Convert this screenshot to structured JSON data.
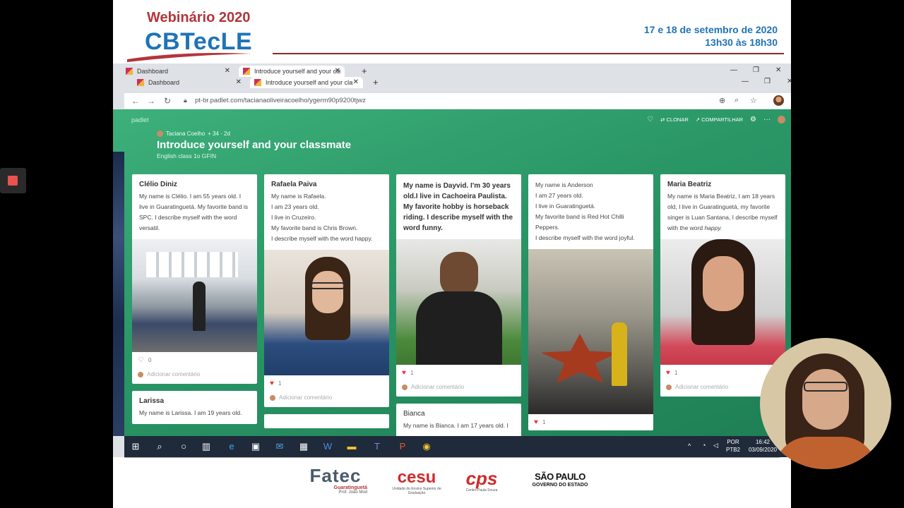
{
  "slide": {
    "webinar": "Webinário 2020",
    "event": "CBTecLE",
    "date": "17 e 18 de setembro de 2020",
    "time": "13h30 às 18h30"
  },
  "browser": {
    "tabs_back": [
      {
        "label": "Dashboard"
      },
      {
        "label": "Introduce yourself and your classm"
      }
    ],
    "tabs_front": [
      {
        "label": "Dashboard"
      },
      {
        "label": "Introduce yourself and your classm"
      }
    ],
    "url": "pt-br.padlet.com/tacianaoliveiracoelho/ygerm90p9200tjwz"
  },
  "padlet": {
    "brand": "padlet",
    "author": "Taciana Coelho",
    "author_stats": "+ 34 · 2d",
    "title": "Introduce yourself and your classmate",
    "subtitle": "English class 1o GFIN",
    "toolbar": {
      "clone": "CLONAR",
      "share": "COMPARTILHAR"
    },
    "add_comment": "Adicionar comentário",
    "cards": [
      {
        "title": "Clélio Diniz",
        "body": "My name is Clélio. I am 55 years old. I live in Guaratinguetá. My favorite band is SPC. I describe myself with the word versatil.",
        "likes": "0"
      },
      {
        "title": "Rafaela Paiva",
        "lines": [
          "My name is Rafaela.",
          "I am 23 years old.",
          "I live in Cruzeiro.",
          "My favorite band is Chris Brown.",
          "I describe myself with the word happy."
        ],
        "likes": "1"
      },
      {
        "title": "",
        "body": "My name is Dayvid. I'm 30 years old.I live in Cachoeira Paulista. My favorite hobby is horseback riding. I describe myself with the word funny.",
        "likes": "1"
      },
      {
        "title": "",
        "lines": [
          "My name is Anderson",
          "I am 27 years old.",
          "I live in Guaratinguetá.",
          "My favorite band is Red Hot Chilli Peppers.",
          "I describe myself with the word joyful."
        ],
        "likes": "1"
      },
      {
        "title": "Maria Beatriz",
        "body_pre": "My name is Maria Beatriz, I am 18 years old, I live in Guaratinguetá, my favorite singer is Luan Santana, I describe myself with the word ",
        "body_em": "happy.",
        "likes": "1"
      },
      {
        "title": "Larissa",
        "body": "My name is Larissa.  I am 19 years old."
      },
      {
        "title": "Bianca",
        "body": "My name is Bianca. I am 17 years old. I"
      }
    ]
  },
  "tray": {
    "lang1": "POR",
    "lang2": "PTB2",
    "clock": "16:42",
    "date": "03/09/2020"
  },
  "footer": {
    "fatec": "Fatec",
    "fatec_sub": "Guaratinguetá",
    "fatec_sub2": "Prof. João Mod",
    "cesu": "cesu",
    "cesu_sub": "Unidade do Ensino Superior de Graduação",
    "cps": "cps",
    "cps_sub": "Centro Paula Souza",
    "sp": "SÃO PAULO",
    "sp_sub": "GOVERNO DO ESTADO"
  },
  "colors": {
    "accent": "#1f73b7",
    "brand_red": "#b4343a",
    "padlet_green": "#2f9f6d"
  }
}
